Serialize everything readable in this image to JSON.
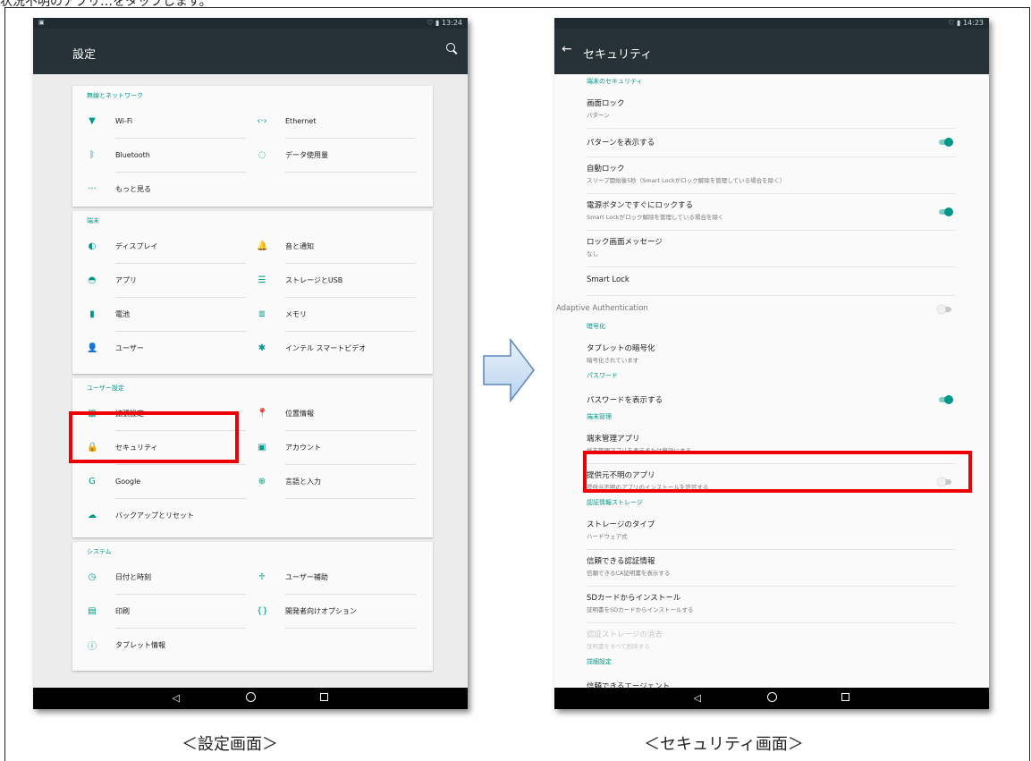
{
  "top_note": "状況不明のアプリ…をタップします。",
  "left": {
    "status_time": "13:24",
    "title": "設定",
    "sections": [
      {
        "header": "無線とネットワーク",
        "items": [
          {
            "label": "Wi-Fi",
            "icon": "wifi-icon",
            "glyph": "▼"
          },
          {
            "label": "Ethernet",
            "icon": "ethernet-icon",
            "glyph": "‹·›"
          },
          {
            "label": "Bluetooth",
            "icon": "bluetooth-icon",
            "glyph": "ᛒ"
          },
          {
            "label": "データ使用量",
            "icon": "data-usage-icon",
            "glyph": "◌"
          },
          {
            "label": "もっと見る",
            "icon": "more-icon",
            "glyph": "···"
          }
        ]
      },
      {
        "header": "端末",
        "items": [
          {
            "label": "ディスプレイ",
            "icon": "display-icon",
            "glyph": "◐"
          },
          {
            "label": "音と通知",
            "icon": "bell-icon",
            "glyph": "🔔"
          },
          {
            "label": "アプリ",
            "icon": "android-icon",
            "glyph": "◓"
          },
          {
            "label": "ストレージとUSB",
            "icon": "storage-icon",
            "glyph": "☰"
          },
          {
            "label": "電池",
            "icon": "battery-icon",
            "glyph": "▮"
          },
          {
            "label": "メモリ",
            "icon": "memory-icon",
            "glyph": "≣"
          },
          {
            "label": "ユーザー",
            "icon": "user-icon",
            "glyph": "👤"
          },
          {
            "label": "インテル スマートビデオ",
            "icon": "gear-icon",
            "glyph": "✱"
          }
        ]
      },
      {
        "header": "ユーザー設定",
        "items": [
          {
            "label": "拡張設定",
            "icon": "grid-icon",
            "glyph": "▦"
          },
          {
            "label": "位置情報",
            "icon": "location-icon",
            "glyph": "📍"
          },
          {
            "label": "セキュリティ",
            "icon": "lock-icon",
            "glyph": "🔒"
          },
          {
            "label": "アカウント",
            "icon": "account-icon",
            "glyph": "▣"
          },
          {
            "label": "Google",
            "icon": "google-icon",
            "glyph": "G"
          },
          {
            "label": "言語と入力",
            "icon": "globe-icon",
            "glyph": "⊕"
          },
          {
            "label": "バックアップとリセット",
            "icon": "cloud-icon",
            "glyph": "☁"
          }
        ]
      },
      {
        "header": "システム",
        "items": [
          {
            "label": "日付と時刻",
            "icon": "clock-icon",
            "glyph": "◷"
          },
          {
            "label": "ユーザー補助",
            "icon": "accessibility-icon",
            "glyph": "♱"
          },
          {
            "label": "印刷",
            "icon": "print-icon",
            "glyph": "▤"
          },
          {
            "label": "開発者向けオプション",
            "icon": "code-icon",
            "glyph": "{}"
          },
          {
            "label": "タブレット情報",
            "icon": "info-icon",
            "glyph": "ⓘ"
          }
        ]
      }
    ],
    "caption": "＜設定画面＞"
  },
  "right": {
    "status_time": "14:23",
    "title": "セキュリティ",
    "rows": [
      {
        "kind": "cat",
        "text": "端末のセキュリティ"
      },
      {
        "kind": "item",
        "title": "画面ロック",
        "sub": "パターン"
      },
      {
        "kind": "item",
        "title": "パターンを表示する",
        "sub": "",
        "toggle": "on"
      },
      {
        "kind": "item",
        "title": "自動ロック",
        "sub": "スリープ開始後5秒（Smart Lockがロック解除を管理している場合を除く）"
      },
      {
        "kind": "item",
        "title": "電源ボタンですぐにロックする",
        "sub": "Smart Lockがロック解除を管理している場合を除く",
        "toggle": "on"
      },
      {
        "kind": "item",
        "title": "ロック画面メッセージ",
        "sub": "なし"
      },
      {
        "kind": "item",
        "title": "Smart Lock",
        "sub": ""
      },
      {
        "kind": "item",
        "title": "Adaptive Authentication",
        "sub": "",
        "toggle": "off",
        "outdent": true
      },
      {
        "kind": "cat",
        "text": "暗号化"
      },
      {
        "kind": "item",
        "title": "タブレットの暗号化",
        "sub": "暗号化されています"
      },
      {
        "kind": "cat",
        "text": "パスワード"
      },
      {
        "kind": "item",
        "title": "パスワードを表示する",
        "sub": "",
        "toggle": "on"
      },
      {
        "kind": "cat",
        "text": "端末管理"
      },
      {
        "kind": "item",
        "title": "端末管理アプリ",
        "sub": "端末管理アプリを表示または無効にする"
      },
      {
        "kind": "item",
        "title": "提供元不明のアプリ",
        "sub": "提供元不明のアプリのインストールを許可する",
        "toggle": "off"
      },
      {
        "kind": "cat",
        "text": "認証情報ストレージ"
      },
      {
        "kind": "item",
        "title": "ストレージのタイプ",
        "sub": "ハードウェア式"
      },
      {
        "kind": "item",
        "title": "信頼できる認証情報",
        "sub": "信頼できるCA証明書を表示する"
      },
      {
        "kind": "item",
        "title": "SDカードからインストール",
        "sub": "証明書をSDカードからインストールする"
      },
      {
        "kind": "item",
        "title": "認証ストレージの消去",
        "sub": "証明書をすべて削除する",
        "disabled": true
      },
      {
        "kind": "cat",
        "text": "詳細設定"
      },
      {
        "kind": "item",
        "title": "信頼できるエージェント",
        "sub": ""
      }
    ],
    "caption": "＜セキュリティ画面＞"
  },
  "colors": {
    "accent": "#009688",
    "appbar": "#263238",
    "highlight": "#ee0000"
  }
}
